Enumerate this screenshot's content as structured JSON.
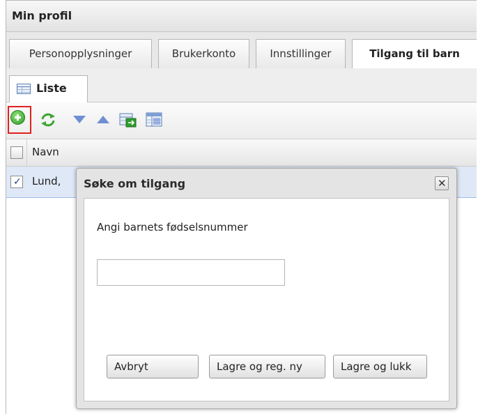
{
  "window": {
    "title": "Min profil"
  },
  "tabs": [
    {
      "label": "Personopplysninger"
    },
    {
      "label": "Brukerkonto"
    },
    {
      "label": "Innstillinger"
    },
    {
      "label": "Tilgang til barn",
      "active": true
    }
  ],
  "subtab": {
    "label": "Liste"
  },
  "toolbar": {
    "icons": [
      "add-icon",
      "refresh-icon",
      "arrow-down-icon",
      "arrow-up-icon",
      "export-icon",
      "columns-icon"
    ],
    "highlight_color": "#e0211d"
  },
  "grid": {
    "header": {
      "name": "Navn"
    },
    "rows": [
      {
        "name": "Lund,",
        "checked": true
      }
    ]
  },
  "dialog": {
    "title": "Søke om tilgang",
    "close_glyph": "✕",
    "field_label": "Angi barnets fødselsnummer",
    "field_value": "",
    "buttons": {
      "cancel": "Avbryt",
      "save_new": "Lagre og reg. ny",
      "save_close": "Lagre og lukk"
    }
  },
  "colors": {
    "selected_row": "#dfe8f6",
    "icon_blue": "#6f8fd3",
    "icon_green": "#2d9b25"
  }
}
